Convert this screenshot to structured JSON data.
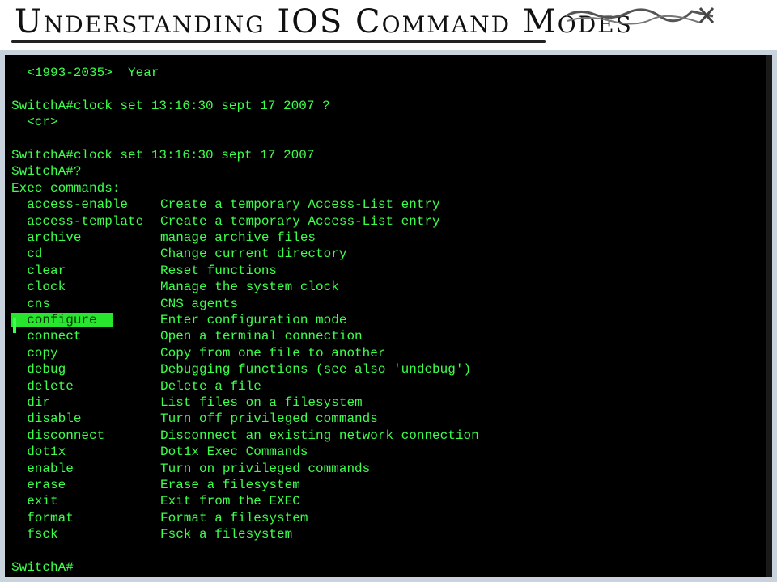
{
  "header": {
    "title": "Understanding IOS Command Modes"
  },
  "terminal": {
    "pre_lines": [
      "  <1993-2035>  Year",
      "",
      "SwitchA#clock set 13:16:30 sept 17 2007 ?",
      "  <cr>",
      "",
      "SwitchA#clock set 13:16:30 sept 17 2007",
      "SwitchA#?",
      "Exec commands:"
    ],
    "commands": [
      {
        "cmd": "access-enable",
        "desc": "Create a temporary Access-List entry"
      },
      {
        "cmd": "access-template",
        "desc": "Create a temporary Access-List entry"
      },
      {
        "cmd": "archive",
        "desc": "manage archive files"
      },
      {
        "cmd": "cd",
        "desc": "Change current directory"
      },
      {
        "cmd": "clear",
        "desc": "Reset functions"
      },
      {
        "cmd": "clock",
        "desc": "Manage the system clock"
      },
      {
        "cmd": "cns",
        "desc": "CNS agents"
      },
      {
        "cmd": "configure",
        "desc": "Enter configuration mode",
        "highlight": true
      },
      {
        "cmd": "connect",
        "desc": "Open a terminal connection"
      },
      {
        "cmd": "copy",
        "desc": "Copy from one file to another"
      },
      {
        "cmd": "debug",
        "desc": "Debugging functions (see also 'undebug')"
      },
      {
        "cmd": "delete",
        "desc": "Delete a file"
      },
      {
        "cmd": "dir",
        "desc": "List files on a filesystem"
      },
      {
        "cmd": "disable",
        "desc": "Turn off privileged commands"
      },
      {
        "cmd": "disconnect",
        "desc": "Disconnect an existing network connection"
      },
      {
        "cmd": "dot1x",
        "desc": "Dot1x Exec Commands"
      },
      {
        "cmd": "enable",
        "desc": "Turn on privileged commands"
      },
      {
        "cmd": "erase",
        "desc": "Erase a filesystem"
      },
      {
        "cmd": "exit",
        "desc": "Exit from the EXEC"
      },
      {
        "cmd": "format",
        "desc": "Format a filesystem"
      },
      {
        "cmd": "fsck",
        "desc": "Fsck a filesystem"
      }
    ],
    "prompt": "SwitchA#",
    "colors": {
      "text": "#3cff4a",
      "background": "#000000",
      "highlight": "#27e62d"
    }
  }
}
